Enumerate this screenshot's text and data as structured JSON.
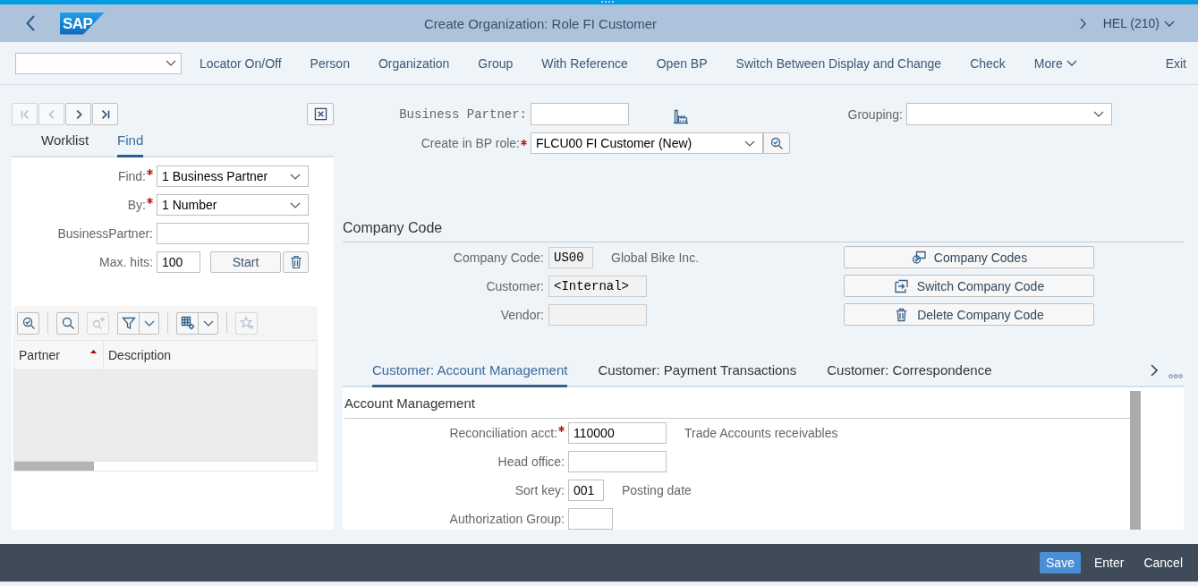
{
  "shell": {
    "logo": "SAP",
    "title": "Create Organization: Role FI Customer",
    "system": "HEL (210)"
  },
  "toolbar": {
    "items": [
      {
        "label": "Locator On/Off",
        "kind": "action"
      },
      {
        "label": "Person",
        "kind": "action"
      },
      {
        "label": "Organization",
        "kind": "action"
      },
      {
        "label": "Group",
        "kind": "action"
      },
      {
        "label": "With Reference",
        "kind": "action"
      },
      {
        "label": "Open BP",
        "kind": "action"
      },
      {
        "label": "Switch Between Display and Change",
        "kind": "action"
      },
      {
        "label": "Check",
        "kind": "action"
      },
      {
        "label": "More",
        "kind": "menu"
      }
    ],
    "exit": "Exit"
  },
  "locator": {
    "nav": [
      {
        "kind": "first",
        "disabled": true
      },
      {
        "kind": "prev",
        "disabled": true
      },
      {
        "kind": "next",
        "disabled": false
      },
      {
        "kind": "last",
        "disabled": false
      }
    ],
    "tabs": [
      {
        "label": "Worklist",
        "selected": false
      },
      {
        "label": "Find",
        "selected": true
      }
    ],
    "search_fields": [
      {
        "label": "Find:",
        "required": true,
        "kind": "select",
        "value": "1 Business Partner"
      },
      {
        "label": "By:",
        "required": true,
        "kind": "select",
        "value": "1 Number"
      },
      {
        "label": "BusinessPartner:",
        "required": false,
        "kind": "input"
      },
      {
        "label": "Max. hits:",
        "required": false,
        "kind": "hits",
        "value": "100"
      }
    ],
    "start_button": "Start",
    "table_toolbar": [
      {
        "buttons": [
          {
            "kind": "details",
            "disabled": false,
            "menu": false
          }
        ]
      },
      {
        "buttons": [
          {
            "kind": "search",
            "disabled": false,
            "menu": false
          },
          {
            "kind": "search-next",
            "disabled": true,
            "menu": false
          },
          {
            "kind": "filter",
            "disabled": false,
            "menu": true
          }
        ]
      },
      {
        "buttons": [
          {
            "kind": "layout",
            "disabled": false,
            "menu": true
          }
        ]
      },
      {
        "buttons": [
          {
            "kind": "favorite",
            "disabled": true,
            "menu": false
          }
        ]
      }
    ],
    "columns": [
      {
        "label": "Partner",
        "sorted": true
      },
      {
        "label": "Description",
        "sorted": false
      }
    ]
  },
  "header": {
    "business_partner": {
      "label": "Business Partner:"
    },
    "bp_role": {
      "label": "Create in BP role:",
      "required": true,
      "value": "FLCU00 FI Customer (New)"
    },
    "grouping": {
      "label": "Grouping:"
    }
  },
  "company_code": {
    "title": "Company Code",
    "fields": [
      {
        "label": "Company Code:",
        "value": "US00",
        "description": "Global Bike Inc.",
        "readonly": true
      },
      {
        "label": "Customer:",
        "value": "<Internal>",
        "readonly": true
      },
      {
        "label": "Vendor:",
        "readonly": true
      }
    ],
    "buttons": [
      {
        "label": "Company Codes",
        "kind": "codes"
      },
      {
        "label": "Switch Company Code",
        "kind": "switch"
      },
      {
        "label": "Delete Company Code",
        "kind": "delete"
      }
    ]
  },
  "detail_tabs": [
    {
      "label": "Customer: Account Management",
      "selected": true
    },
    {
      "label": "Customer: Payment Transactions",
      "selected": false
    },
    {
      "label": "Customer: Correspondence",
      "selected": false
    }
  ],
  "account_management": {
    "title": "Account Management",
    "fields": [
      {
        "label": "Reconciliation acct:",
        "required": true,
        "value": "110000",
        "description": "Trade Accounts receivables"
      },
      {
        "label": "Head office:",
        "required": false
      },
      {
        "label": "Sort key:",
        "required": false,
        "value": "001",
        "description": "Posting date"
      },
      {
        "label": "Authorization Group:",
        "required": false
      }
    ]
  },
  "footer": {
    "buttons": [
      {
        "label": "Save",
        "kind": "emphasized"
      },
      {
        "label": "Enter",
        "kind": "plain"
      },
      {
        "label": "Cancel",
        "kind": "plain"
      }
    ]
  }
}
